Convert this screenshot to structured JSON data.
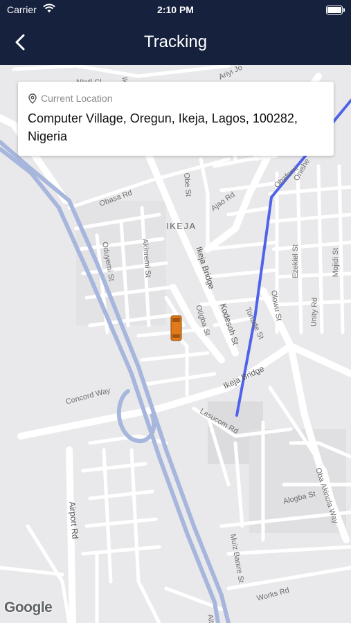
{
  "status_bar": {
    "carrier": "Carrier",
    "time": "2:10 PM"
  },
  "nav": {
    "title": "Tracking"
  },
  "location_card": {
    "label": "Current Location",
    "address": "Computer Village, Oregun, Ikeja, Lagos, 100282, Nigeria"
  },
  "map": {
    "area_label": "IKEJA",
    "streets": {
      "niwil_cl": "Niwil Cl",
      "ikeja_top": "Ikeja",
      "ariyi_jo": "Ariyi Jo",
      "obafemi": "Obafemi",
      "onishe": "Onishe",
      "obasa_rd": "Obasa Rd",
      "obe_st": "Obe St",
      "ajao_rd": "Ajao Rd",
      "oduyemi_st": "Oduyemi St",
      "akinremi_st": "Akinremi St",
      "ikeja_bridge_v": "Ikeja Bridge",
      "kodesoh_st": "Kodesoh St",
      "otigba_st": "Otigba St",
      "tonade_st": "Tonade St",
      "olowu_st": "Olowu St",
      "ezekiel_st": "Ezekiel St",
      "unity_rd": "Unity Rd",
      "mojidi_st": "Mojidi St",
      "ikeja_bridge_d": "Ikeja Bridge",
      "concord_way": "Concord Way",
      "lasucom_rd": "Lasucom Rd",
      "airport_rd": "Airport Rd",
      "oba_akinola": "Oba Akinola Way",
      "alogba_st": "Alogba St",
      "muiz_banire_st": "Muiz Banire St",
      "works_rd": "Works Rd",
      "alt": "Alt"
    },
    "attribution": "Google"
  },
  "colors": {
    "header_bg": "#16213e",
    "route": "#4f63ea",
    "highway": "#a7b6dc",
    "vehicle": "#e07a1a"
  }
}
